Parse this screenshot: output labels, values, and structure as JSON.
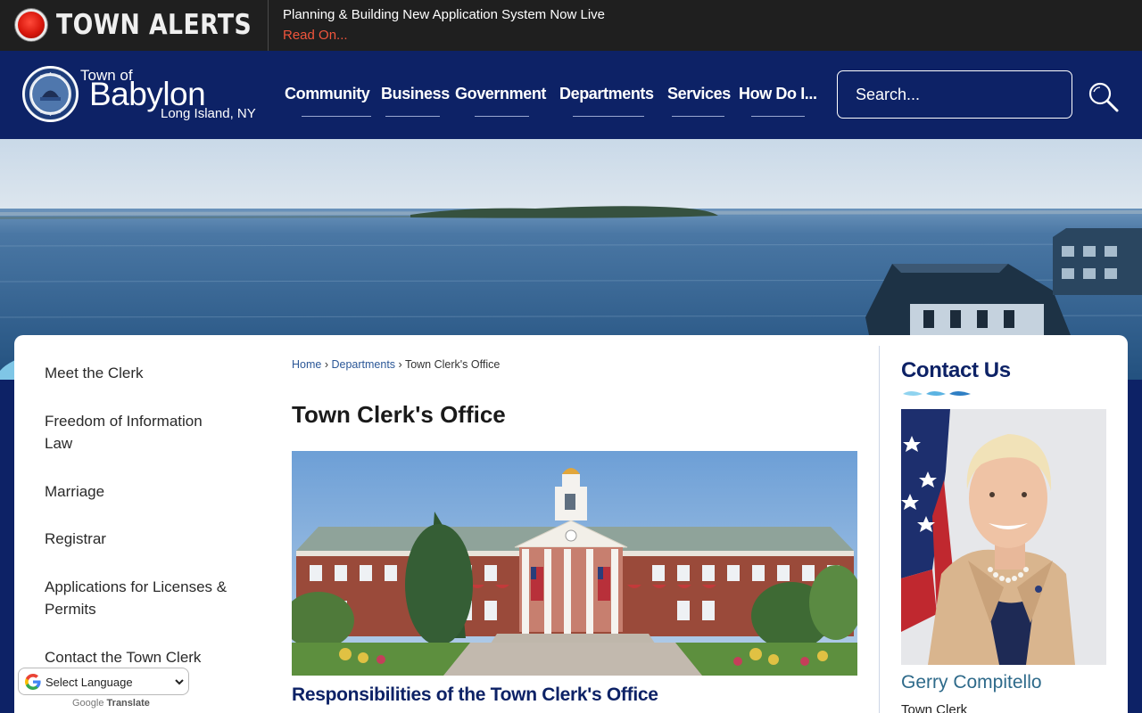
{
  "alert": {
    "title": "TOWN ALERTS",
    "message": "Planning & Building New Application System Now Live",
    "link": "Read On..."
  },
  "logo": {
    "line1": "Town of",
    "line2": "Babylon",
    "line3": "Long Island, NY"
  },
  "nav": {
    "items": [
      "Community",
      "Business",
      "Government",
      "Departments",
      "Services",
      "How Do I..."
    ]
  },
  "search": {
    "placeholder": "Search..."
  },
  "sidebar": {
    "items": [
      {
        "label": "Meet the Clerk"
      },
      {
        "label1": "Freedom of Information",
        "label2": "Law"
      },
      {
        "label": "Marriage"
      },
      {
        "label": "Registrar"
      },
      {
        "label1": "Applications for Licenses &",
        "label2": "Permits"
      },
      {
        "label": "Contact the Town Clerk"
      }
    ]
  },
  "breadcrumb": {
    "home": "Home",
    "sep": "›",
    "departments": "Departments",
    "current": "Town Clerk's Office"
  },
  "main": {
    "title": "Town Clerk's Office",
    "section_heading": "Responsibilities of the Town Clerk's Office"
  },
  "contact": {
    "title": "Contact Us",
    "name": "Gerry Compitello",
    "role": "Town Clerk"
  },
  "translate": {
    "select_label": "Select Language",
    "powered_by": "Google",
    "translate_word": "Translate"
  },
  "colors": {
    "navy": "#0d2266",
    "alert_bg": "#1f1f1f",
    "alert_link": "#f0553c",
    "name_teal": "#2e6a8a"
  }
}
